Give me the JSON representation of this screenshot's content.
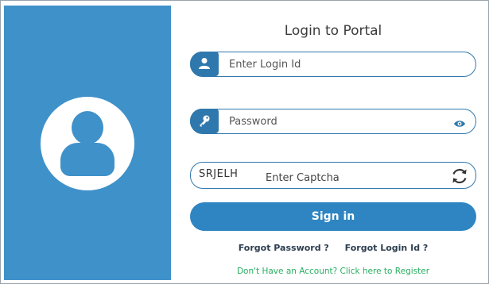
{
  "title": "Login to Portal",
  "login": {
    "placeholder": "Enter Login Id",
    "icon": "user-icon"
  },
  "password": {
    "placeholder": "Password",
    "icon": "key-icon",
    "toggle_icon": "eye-icon"
  },
  "captcha": {
    "code": "SRJELH",
    "placeholder": "Enter Captcha",
    "refresh_icon": "refresh-icon"
  },
  "signin_label": "Sign in",
  "links": {
    "forgot_password": "Forgot Password ?",
    "forgot_login_id": "Forgot Login Id ?"
  },
  "register_text": "Don't Have an Account? Click here to Register",
  "colors": {
    "panel": "#3f91c9",
    "accent": "#2f78ad",
    "button": "#2f85c2",
    "register": "#27ae60"
  }
}
